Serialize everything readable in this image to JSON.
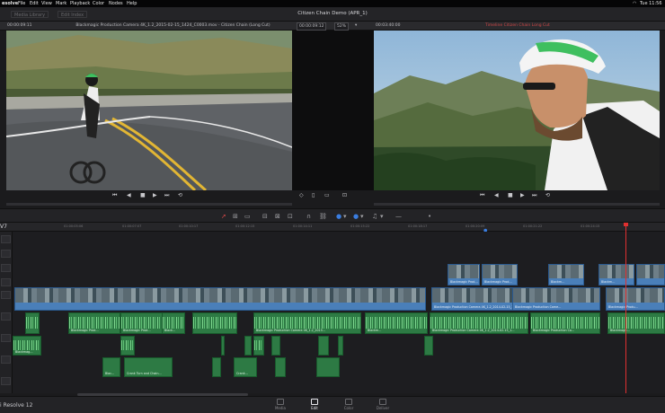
{
  "menubar": {
    "app": "esolve",
    "items": [
      "File",
      "Edit",
      "View",
      "Mark",
      "Playback",
      "Color",
      "Nodes",
      "Help"
    ],
    "clock": "Tue 11:56"
  },
  "toolbar": {
    "media_library": "Media Library",
    "edit_index": "Edit Index",
    "project_title": "Citizen Chain Demo (APR_1)"
  },
  "viewer": {
    "source_timecode": "00:00:09:11",
    "source_clip": "Blackmagic Production Camera 4K_1.2_2015-02-15_1424_C0003.mov - Citizen Chain (Long Cut)",
    "center_timecode": "00:00:09:12",
    "zoom": "52%",
    "record_timecode": "00:03:40:00",
    "record_clip": "Timeline Citizen Chain Long Cut"
  },
  "timeline": {
    "track_label": "V7",
    "ruler": [
      "01:00:05:06",
      "01:00:07:07",
      "01:00:10:17",
      "01:00:12:15",
      "01:00:14:11",
      "01:00:15:22",
      "01:00:18:17",
      "01:00:20:09",
      "01:00:21:22",
      "01:00:24:15"
    ],
    "v2_clips": [
      "Blackmagic Prod…",
      "Blackmagic Prod…",
      "Blackm…",
      "Blackm…"
    ],
    "v1_clips": [
      "Blackmagic Production Camera 4K_1.2_2014-02-15_1…",
      "Blackmagic Production Came…",
      "Blackmagic Produ…"
    ],
    "a1_clips": [
      "Blackmagic Prod…",
      "Blackmagic Prod…",
      "Black…",
      "Blackmagic Production Camera 4K_1.2_2015…",
      "Blackm…",
      "Blackmagic Production Camera 4K_1.2_2014-02-15_1…",
      "Blackmagic Production Ca…",
      "Blackmagic…"
    ],
    "a2_clips": [
      "Blackmag…"
    ],
    "a3_clips": [
      "Blac…",
      "Crank Turn and Chain…",
      "Crank…"
    ]
  },
  "pages": {
    "resolve_label": "i Resolve 12",
    "items": [
      "Media",
      "Edit",
      "Color",
      "Deliver"
    ],
    "active": "Edit"
  }
}
